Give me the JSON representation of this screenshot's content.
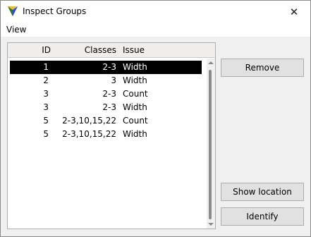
{
  "window": {
    "title": "Inspect Groups",
    "close_glyph": "✕"
  },
  "menu": {
    "view": "View"
  },
  "table": {
    "headers": {
      "id": "ID",
      "classes": "Classes",
      "issue": "Issue"
    },
    "rows": [
      {
        "id": "1",
        "classes": "2-3",
        "issue": "Width",
        "selected": true
      },
      {
        "id": "2",
        "classes": "3",
        "issue": "Width"
      },
      {
        "id": "3",
        "classes": "2-3",
        "issue": "Count"
      },
      {
        "id": "3",
        "classes": "2-3",
        "issue": "Width"
      },
      {
        "id": "5",
        "classes": "2-3,10,15,22",
        "issue": "Count"
      },
      {
        "id": "5",
        "classes": "2-3,10,15,22",
        "issue": "Width"
      }
    ]
  },
  "buttons": {
    "remove": "Remove",
    "show_location": "Show location",
    "identify": "Identify"
  }
}
